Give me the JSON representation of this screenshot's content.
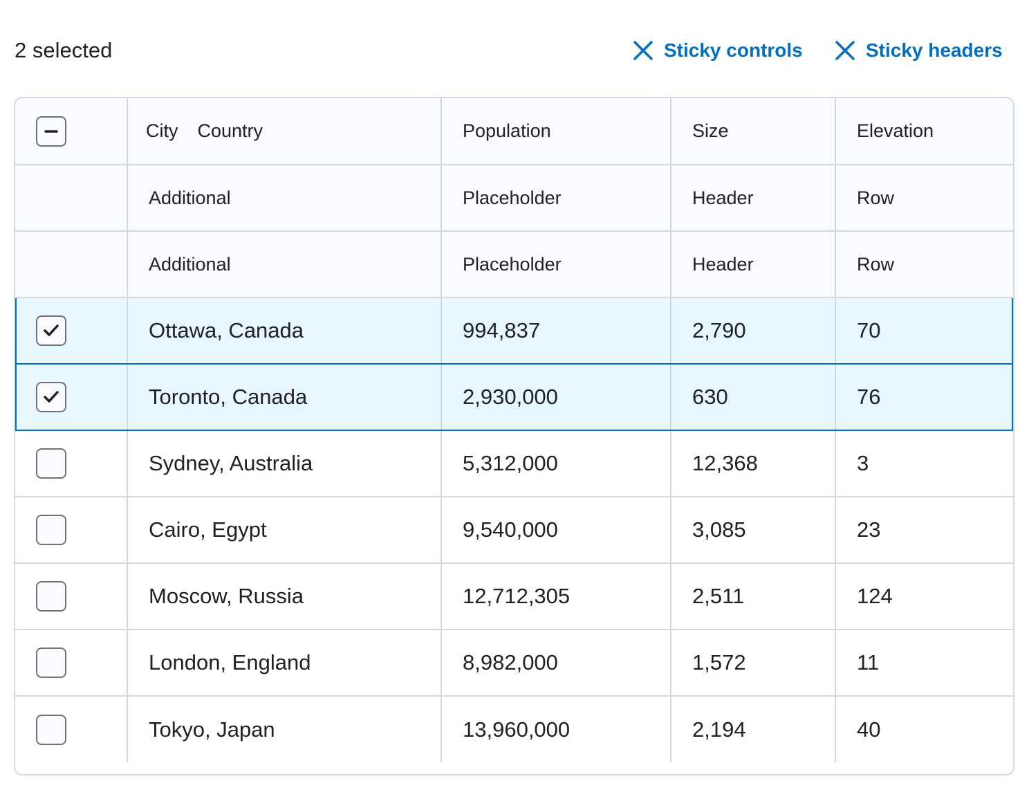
{
  "toolbar": {
    "selected_count": "2 selected",
    "sticky_controls_label": "Sticky controls",
    "sticky_headers_label": "Sticky headers",
    "accent_color": "#006fbf"
  },
  "table": {
    "header": {
      "city": "City",
      "country": "Country",
      "population": "Population",
      "size": "Size",
      "elevation": "Elevation",
      "select_all_state": "indeterminate"
    },
    "placeholder_rows": [
      {
        "c1": "Additional",
        "c2": "Placeholder",
        "c3": "Header",
        "c4": "Row"
      },
      {
        "c1": "Additional",
        "c2": "Placeholder",
        "c3": "Header",
        "c4": "Row"
      }
    ],
    "rows": [
      {
        "location": "Ottawa, Canada",
        "population": "994,837",
        "size": "2,790",
        "elevation": "70",
        "selected": true
      },
      {
        "location": "Toronto, Canada",
        "population": "2,930,000",
        "size": "630",
        "elevation": "76",
        "selected": true
      },
      {
        "location": "Sydney, Australia",
        "population": "5,312,000",
        "size": "12,368",
        "elevation": "3",
        "selected": false
      },
      {
        "location": "Cairo, Egypt",
        "population": "9,540,000",
        "size": "3,085",
        "elevation": "23",
        "selected": false
      },
      {
        "location": "Moscow, Russia",
        "population": "12,712,305",
        "size": "2,511",
        "elevation": "124",
        "selected": false
      },
      {
        "location": "London, England",
        "population": "8,982,000",
        "size": "1,572",
        "elevation": "11",
        "selected": false
      },
      {
        "location": "Tokyo, Japan",
        "population": "13,960,000",
        "size": "2,194",
        "elevation": "40",
        "selected": false
      }
    ]
  }
}
